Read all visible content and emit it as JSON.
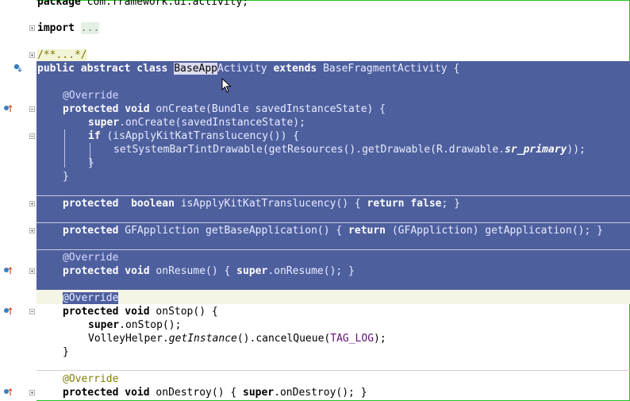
{
  "editor": {
    "lines": {
      "l_pkg": {
        "kw": "package",
        "rest": " com.framework.ui.activity;"
      },
      "l_import": {
        "kw": "import",
        "fold": "..."
      },
      "l_doc": {
        "fold": "/**...*/"
      },
      "l_class": {
        "p1": "public",
        "p2": "abstract",
        "p3": "class",
        "name_a": "BaseApp",
        "name_b": "Activity",
        "p4": "extends",
        "rest": "BaseFragmentActivity {"
      },
      "l_ov1": {
        "ann": "@Override"
      },
      "l_oncreate": {
        "p1": "protected",
        "p2": "void",
        "rest": "onCreate(Bundle savedInstanceState) {"
      },
      "l_super1": {
        "p1": "super",
        "rest": ".onCreate(savedInstanceState);"
      },
      "l_if": {
        "p1": "if",
        "rest": " (isApplyKitKatTranslucency()) {"
      },
      "l_settint": {
        "a": "setSystemBarTintDrawable(getResources().getDrawable(R.drawable.",
        "b": "sr_primary",
        "c": "));"
      },
      "l_close_if": {
        "text": "}"
      },
      "l_close_m": {
        "text": "}"
      },
      "l_isapply": {
        "p1": "protected",
        "p2": "boolean",
        "a": "isApplyKitKatTranslucency() { ",
        "p3": "return",
        "p4": "false",
        "b": "; }"
      },
      "l_getbase": {
        "p1": "protected",
        "a": "GFAppliction getBaseApplication() { ",
        "p2": "return",
        "b": " (GFAppliction) getApplication(); }"
      },
      "l_ov2": {
        "ann": "@Override"
      },
      "l_onresume": {
        "p1": "protected",
        "p2": "void",
        "a": "onResume() { ",
        "p3": "super",
        "b": ".onResume(); }"
      },
      "l_ov3": {
        "ann": "@Override"
      },
      "l_onstop": {
        "p1": "protected",
        "p2": "void",
        "rest": "onStop() {"
      },
      "l_super2": {
        "p1": "super",
        "rest": ".onStop();"
      },
      "l_volley": {
        "a": "VolleyHelper.",
        "b": "getInstance",
        "c": "().cancelQueue(",
        "d": "TAG_LOG",
        "e": ");"
      },
      "l_close_stop": {
        "text": "}"
      },
      "l_ov4": {
        "ann": "@Override"
      },
      "l_ondestroy": {
        "p1": "protected",
        "p2": "void",
        "a": "onDestroy() { ",
        "p3": "super",
        "b": ".onDestroy(); }"
      }
    }
  },
  "colors": {
    "selection": "#4e5f9e",
    "frame": "#22c522",
    "annotation": "#808000"
  }
}
